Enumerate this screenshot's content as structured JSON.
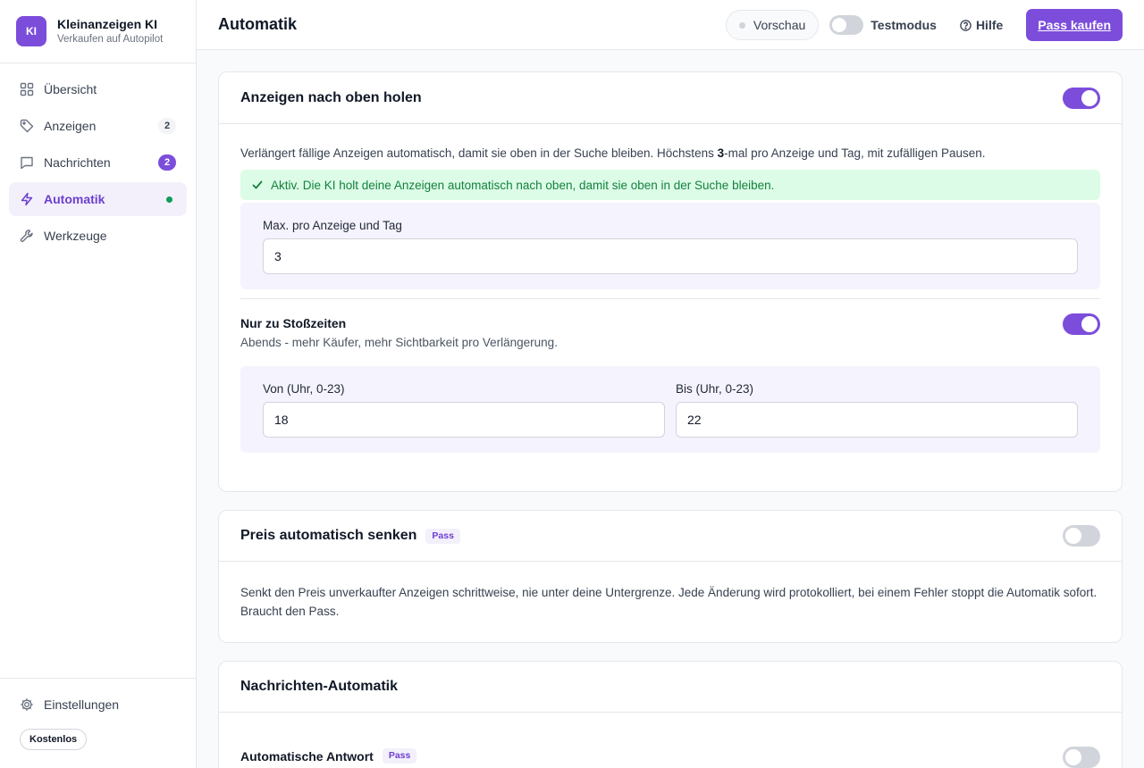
{
  "brand": {
    "logo": "KI",
    "name": "Kleinanzeigen KI",
    "subtitle": "Verkaufen auf Autopilot"
  },
  "sidebar": {
    "items": [
      {
        "label": "Übersicht",
        "icon": "grid-icon"
      },
      {
        "label": "Anzeigen",
        "icon": "tag-icon",
        "badge": "2"
      },
      {
        "label": "Nachrichten",
        "icon": "message-icon",
        "badge": "2"
      },
      {
        "label": "Automatik",
        "icon": "bolt-icon",
        "active": true,
        "status_dot": "green"
      },
      {
        "label": "Werkzeuge",
        "icon": "wrench-icon"
      }
    ],
    "settings_label": "Einstellungen",
    "plan_label": "Kostenlos"
  },
  "header": {
    "title": "Automatik",
    "preview_label": "Vorschau",
    "testmode_label": "Testmodus",
    "testmode_on": false,
    "help_label": "Hilfe",
    "buy_label": "Pass kaufen"
  },
  "cards": {
    "bump": {
      "title": "Anzeigen nach oben holen",
      "enabled": true,
      "desc_pre": "Verlängert fällige Anzeigen automatisch, damit sie oben in der Suche bleiben. Höchstens ",
      "desc_bold": "3",
      "desc_post": "-mal pro Anzeige und Tag, mit zufälligen Pausen.",
      "alert": "Aktiv. Die KI holt deine Anzeigen automatisch nach oben, damit sie oben in der Suche bleiben.",
      "max_label": "Max. pro Anzeige und Tag",
      "max_value": "3",
      "peak": {
        "title": "Nur zu Stoßzeiten",
        "desc": "Abends - mehr Käufer, mehr Sichtbarkeit pro Verlängerung.",
        "enabled": true,
        "from_label": "Von (Uhr, 0-23)",
        "from_value": "18",
        "to_label": "Bis (Uhr, 0-23)",
        "to_value": "22"
      }
    },
    "price": {
      "title": "Preis automatisch senken",
      "badge": "Pass",
      "enabled": false,
      "desc": "Senkt den Preis unverkaufter Anzeigen schrittweise, nie unter deine Untergrenze. Jede Änderung wird protokolliert, bei einem Fehler stoppt die Automatik sofort. Braucht den Pass."
    },
    "messages": {
      "title": "Nachrichten-Automatik",
      "auto_reply_title": "Automatische Antwort",
      "auto_reply_badge": "Pass",
      "auto_reply_enabled": false
    }
  },
  "colors": {
    "accent": "#7c4ddb",
    "success_bg": "#dcfce7",
    "success_text": "#15803d",
    "panel_bg": "#f5f3fd"
  }
}
